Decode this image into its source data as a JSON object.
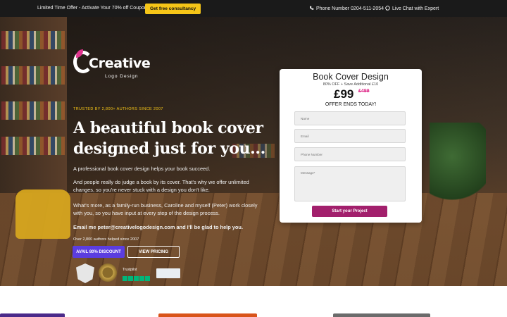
{
  "topbar": {
    "offer_text": "Limited Time Offer - Activate Your 70% off Coupon!",
    "cta_label": "Get free consultancy",
    "phone_text": "Phone Number 0204-511-2054",
    "chat_text": "Live Chat with Expert"
  },
  "brand": {
    "name": "Creative",
    "subtitle": "Logo Design"
  },
  "hero": {
    "trusted": "TRUSTED BY 2,800+ AUTHORS SINCE 2007",
    "headline": "A beautiful book cover designed just for you...",
    "p1": "A professional book cover design helps your book succeed.",
    "p2": "And people really do judge a book by its cover. That's why we offer unlimited changes, so you're never stuck with a design you don't like.",
    "p3": "What's more, as a family-run business, Caroline and myself (Peter) work closely with you, so you have input at every step of the design process.",
    "email": "Email me peter@creativelogodesign.com and I'll be glad to help you.",
    "helped": "Over 2,800 authors helped since 2007",
    "discount_button": "AVAIL 80% DISCOUNT",
    "pricing_button": "VIEW PRICING",
    "trustpilot": "Trustpilot"
  },
  "form": {
    "title": "Book Cover Design",
    "subtitle": "80% OFF + Save Additional £10",
    "price": "£99",
    "old_price": "£499",
    "offer_ends": "OFFER ENDS TODAY!",
    "name_placeholder": "Name",
    "email_placeholder": "Email",
    "phone_placeholder": "Phone Number",
    "message_placeholder": "Message*",
    "submit_label": "Start your Project"
  },
  "colors": {
    "accent_yellow": "#f5c518",
    "accent_purple": "#5b3de0",
    "submit_magenta": "#a21f6c",
    "brand_pink": "#e0358f"
  }
}
